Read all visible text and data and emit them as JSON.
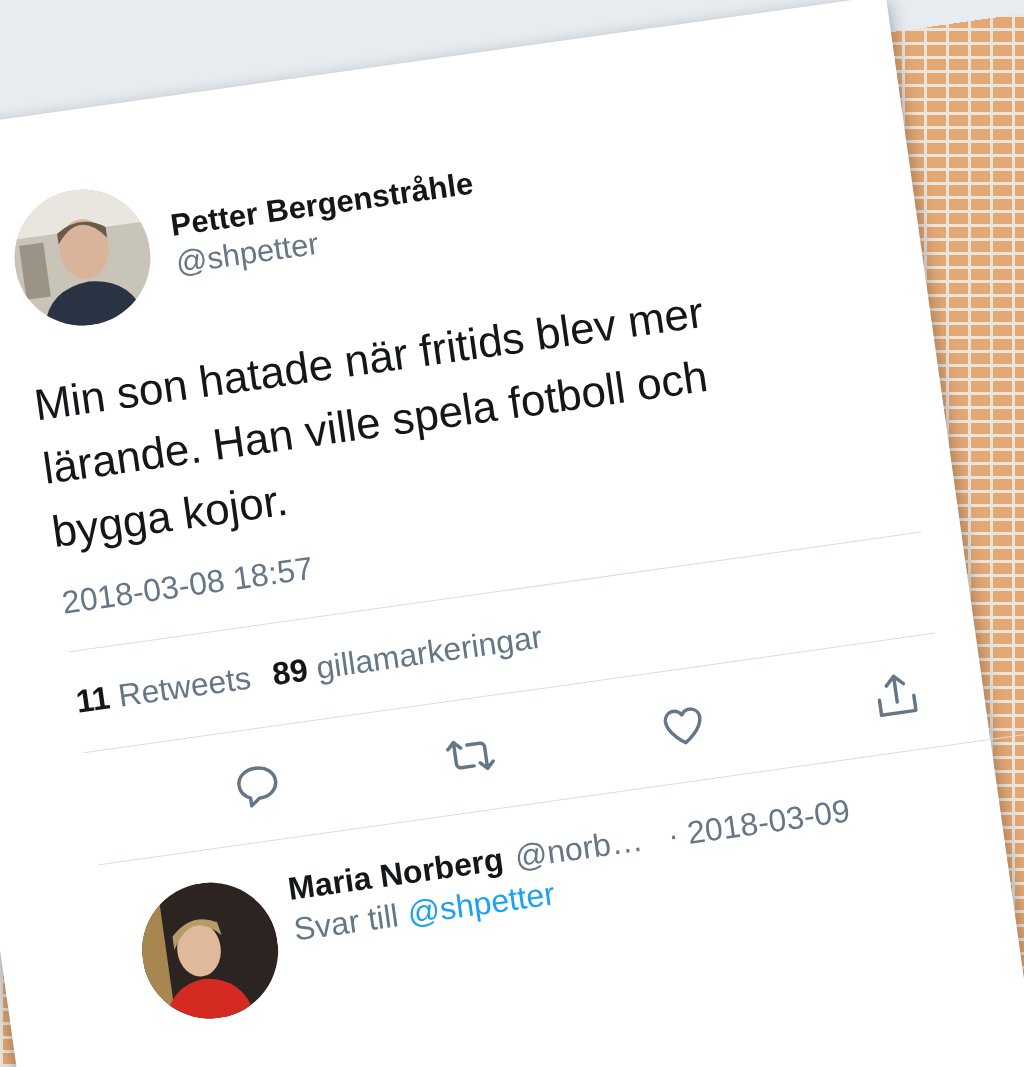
{
  "tweet": {
    "author": {
      "name": "Petter Bergenstråhle",
      "handle": "@shpetter"
    },
    "text": "Min son hatade när fritids blev mer lärande. Han ville spela fotboll och bygga kojor.",
    "timestamp": "2018-03-08 18:57",
    "stats": [
      {
        "count": "11",
        "label": "Retweets"
      },
      {
        "count": "89",
        "label": "gillamarkeringar"
      }
    ],
    "actions": [
      {
        "kind": "reply"
      },
      {
        "kind": "retweet"
      },
      {
        "kind": "like"
      },
      {
        "kind": "share"
      }
    ]
  },
  "reply": {
    "name": "Maria Norberg",
    "handle": "@norb…",
    "date": "· 2018-03-09",
    "reply_prefix": "Svar till",
    "reply_to": "@shpetter"
  }
}
